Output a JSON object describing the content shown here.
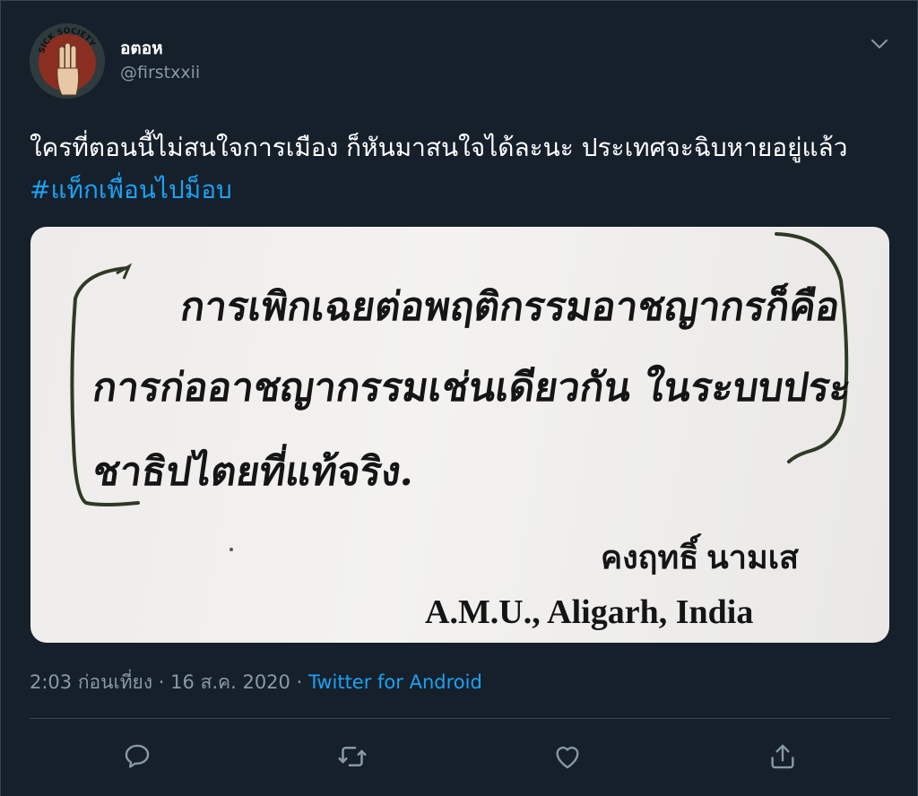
{
  "user": {
    "display_name": "อตอห",
    "handle": "@firstxxii",
    "avatar_text": "SICK SOCIETY"
  },
  "tweet": {
    "text": "ใครที่ตอนนี้ไม่สนใจการเมือง ก็หันมาสนใจได้ละนะ ประเทศจะฉิบหายอยู่แล้ว",
    "hashtag": "#แท็กเพื่อนไปม็อบ"
  },
  "media": {
    "lines": [
      "การเพิกเฉยต่อพฤติกรรมอาชญากรก็คือ",
      "การก่ออาชญากรรมเช่นเดียวกัน ในระบบประ",
      "ชาธิปไตยที่แท้จริง."
    ],
    "signature_name": "คงฤทธิ์ นามเส",
    "signature_place": "A.M.U., Aligarh, India"
  },
  "meta": {
    "time": "2:03 ก่อนเที่ยง",
    "separator": "·",
    "date": "16 ส.ค. 2020",
    "source": "Twitter for Android"
  },
  "icons": {
    "more": "chevron-down-icon",
    "reply": "reply-icon",
    "retweet": "retweet-icon",
    "like": "heart-icon",
    "share": "share-icon"
  },
  "colors": {
    "background": "#15202b",
    "accent": "#1da1f2",
    "muted": "#8899a6",
    "border": "#38444d",
    "text": "#ffffff"
  }
}
